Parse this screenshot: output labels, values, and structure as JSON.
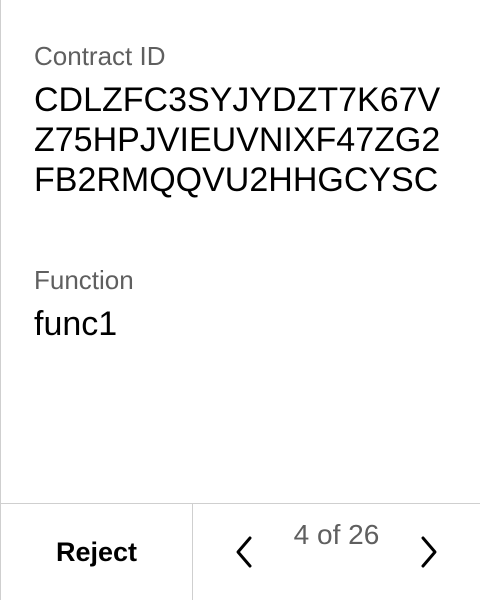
{
  "fields": {
    "contract_label": "Contract ID",
    "contract_value": "CDLZFC3SYJYDZT7K67VZ75HPJVIEUVNIXF47ZG2FB2RMQQVU2HHGCYSC",
    "function_label": "Function",
    "function_value": "func1"
  },
  "footer": {
    "reject_label": "Reject",
    "page_indicator": "4 of 26",
    "prev_icon": "chevron-left-icon",
    "next_icon": "chevron-right-icon"
  }
}
